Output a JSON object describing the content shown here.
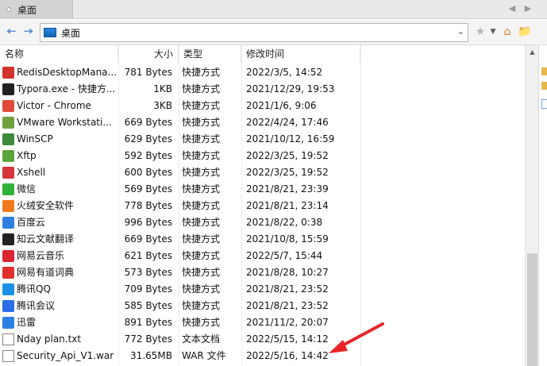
{
  "tab": {
    "label": "桌面"
  },
  "address": {
    "path": "桌面"
  },
  "columns": {
    "name": "名称",
    "size": "大小",
    "type": "类型",
    "date": "修改时间"
  },
  "files": [
    {
      "name": "RedisDesktopMana...",
      "size": "781 Bytes",
      "type": "快捷方式",
      "date": "2022/3/5, 14:52",
      "icon": "redis-icon",
      "color": "#d0342c"
    },
    {
      "name": "Typora.exe - 快捷方...",
      "size": "1KB",
      "type": "快捷方式",
      "date": "2021/12/29, 19:53",
      "icon": "typora-icon",
      "color": "#222222"
    },
    {
      "name": "Victor - Chrome",
      "size": "3KB",
      "type": "快捷方式",
      "date": "2021/1/6, 9:06",
      "icon": "chrome-icon",
      "color": "#e04a3b"
    },
    {
      "name": "VMware Workstati...",
      "size": "669 Bytes",
      "type": "快捷方式",
      "date": "2022/4/24, 17:46",
      "icon": "vmware-icon",
      "color": "#6fa13e"
    },
    {
      "name": "WinSCP",
      "size": "629 Bytes",
      "type": "快捷方式",
      "date": "2021/10/12, 16:59",
      "icon": "winscp-icon",
      "color": "#3c8b3c"
    },
    {
      "name": "Xftp",
      "size": "592 Bytes",
      "type": "快捷方式",
      "date": "2022/3/25, 19:52",
      "icon": "xftp-icon",
      "color": "#5aa43a"
    },
    {
      "name": "Xshell",
      "size": "600 Bytes",
      "type": "快捷方式",
      "date": "2022/3/25, 19:52",
      "icon": "xshell-icon",
      "color": "#d8343b"
    },
    {
      "name": "微信",
      "size": "569 Bytes",
      "type": "快捷方式",
      "date": "2021/8/21, 23:39",
      "icon": "wechat-icon",
      "color": "#2fb13a"
    },
    {
      "name": "火绒安全软件",
      "size": "778 Bytes",
      "type": "快捷方式",
      "date": "2021/8/21, 23:14",
      "icon": "huorong-icon",
      "color": "#f07a1e"
    },
    {
      "name": "百度云",
      "size": "996 Bytes",
      "type": "快捷方式",
      "date": "2021/8/22, 0:38",
      "icon": "baiduyun-icon",
      "color": "#2f7fe0"
    },
    {
      "name": "知云文献翻译",
      "size": "669 Bytes",
      "type": "快捷方式",
      "date": "2021/10/8, 15:59",
      "icon": "zhiyun-icon",
      "color": "#222222"
    },
    {
      "name": "网易云音乐",
      "size": "621 Bytes",
      "type": "快捷方式",
      "date": "2022/5/7, 15:44",
      "icon": "netease-music-icon",
      "color": "#d9262f"
    },
    {
      "name": "网易有道词典",
      "size": "573 Bytes",
      "type": "快捷方式",
      "date": "2021/8/28, 10:27",
      "icon": "youdao-icon",
      "color": "#e0302e"
    },
    {
      "name": "腾讯QQ",
      "size": "709 Bytes",
      "type": "快捷方式",
      "date": "2021/8/21, 23:52",
      "icon": "qq-icon",
      "color": "#1c8fe6"
    },
    {
      "name": "腾讯会议",
      "size": "585 Bytes",
      "type": "快捷方式",
      "date": "2021/8/21, 23:52",
      "icon": "tencent-meeting-icon",
      "color": "#2a6ee8"
    },
    {
      "name": "迅雷",
      "size": "891 Bytes",
      "type": "快捷方式",
      "date": "2021/11/2, 20:07",
      "icon": "xunlei-icon",
      "color": "#2b7fe3"
    },
    {
      "name": "Nday plan.txt",
      "size": "772 Bytes",
      "type": "文本文档",
      "date": "2022/5/15, 14:12",
      "icon": "text-file-icon",
      "color": "#ffffff"
    },
    {
      "name": "Security_Api_V1.war",
      "size": "31.65MB",
      "type": "WAR 文件",
      "date": "2022/5/16, 14:42",
      "icon": "war-file-icon",
      "color": "#ffffff"
    }
  ],
  "colors": {
    "accent": "#2f7fe0",
    "arrow": "#e8262a",
    "tab_bg": "#d3d3d3"
  }
}
